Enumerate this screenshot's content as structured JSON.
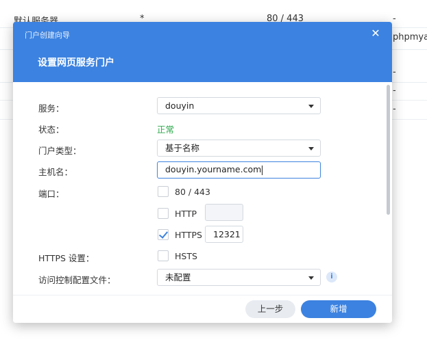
{
  "background": {
    "row1": {
      "name": "默认服务器",
      "host": "*",
      "port": "80 / 443",
      "extra": "-"
    },
    "row2": {
      "extra": "phpmya"
    },
    "row3": {
      "extra": "-"
    },
    "row4": {
      "extra": "-"
    },
    "row5": {
      "extra": "-"
    }
  },
  "dialog": {
    "title": "门户创建向导",
    "close_icon": "✕",
    "heading": "设置网页服务门户",
    "form": {
      "service_label": "服务：",
      "service_value": "douyin",
      "status_label": "状态：",
      "status_value": "正常",
      "portal_type_label": "门户类型：",
      "portal_type_value": "基于名称",
      "hostname_label": "主机名：",
      "hostname_value": "douyin.yourname.com",
      "port_label": "端口：",
      "port_default_label": "80 / 443",
      "port_http_label": "HTTP",
      "port_http_value": "",
      "port_https_label": "HTTPS",
      "port_https_value": "12321",
      "https_settings_label": "HTTPS 设置：",
      "hsts_label": "HSTS",
      "access_profile_label": "访问控制配置文件：",
      "access_profile_value": "未配置",
      "info_icon": "i"
    },
    "footer": {
      "prev_label": "上一步",
      "add_label": "新增"
    }
  },
  "colors": {
    "accent": "#3c82e0",
    "status_ok": "#2aa84a"
  }
}
